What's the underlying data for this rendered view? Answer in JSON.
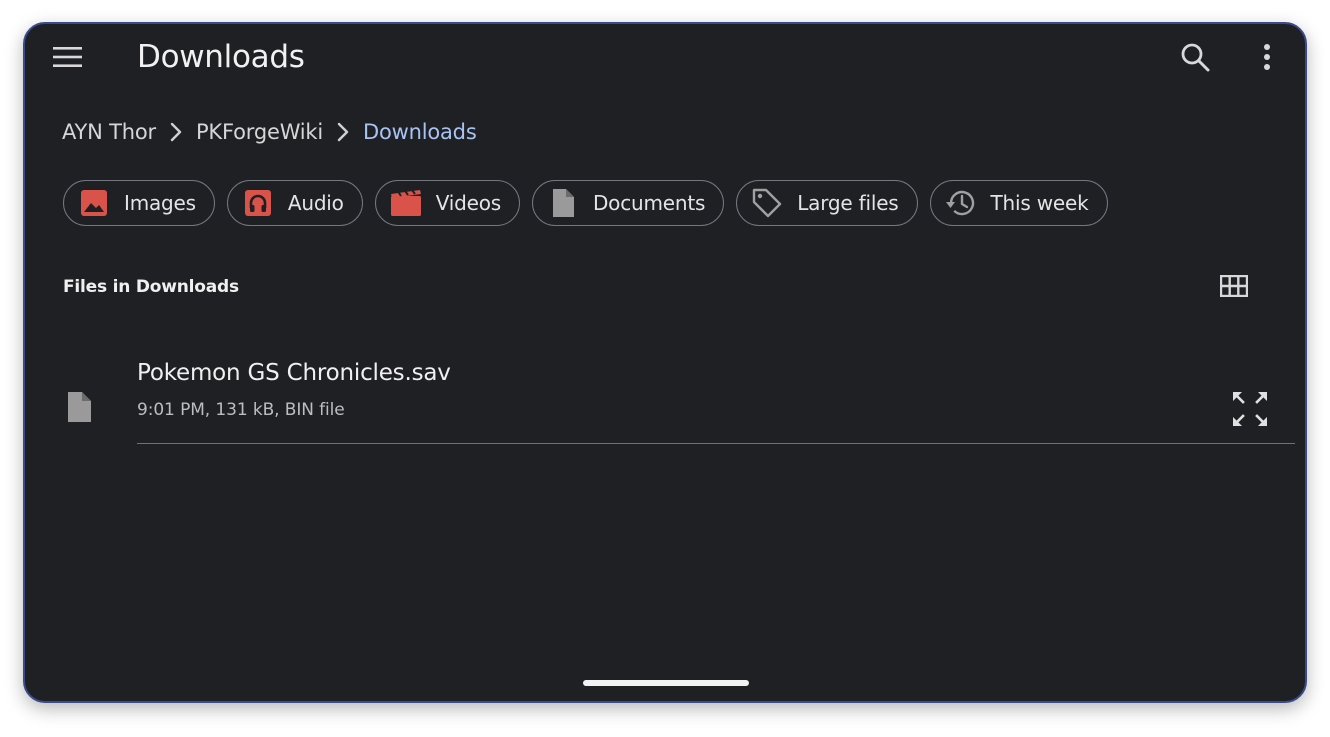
{
  "appbar": {
    "title": "Downloads",
    "menu_icon": "hamburger-menu-icon",
    "search_icon": "search-icon",
    "more_icon": "more-vert-icon"
  },
  "breadcrumb": {
    "items": [
      "AYN Thor",
      "PKForgeWiki",
      "Downloads"
    ],
    "separator_icon": "chevron-right-icon"
  },
  "chips": [
    {
      "label": "Images",
      "icon": "image-icon"
    },
    {
      "label": "Audio",
      "icon": "headphones-icon"
    },
    {
      "label": "Videos",
      "icon": "movie-icon"
    },
    {
      "label": "Documents",
      "icon": "document-icon"
    },
    {
      "label": "Large files",
      "icon": "tag-icon"
    },
    {
      "label": "This week",
      "icon": "history-icon"
    }
  ],
  "section": {
    "label": "Files in Downloads",
    "view_toggle_icon": "grid-view-icon"
  },
  "files": [
    {
      "name": "Pokemon GS Chronicles.sav",
      "meta": "9:01 PM, 131 kB, BIN file",
      "icon": "file-icon",
      "action_icon": "expand-icon"
    }
  ],
  "colors": {
    "background": "#1f2024",
    "accent": "#a8c3f2",
    "chip_icon_red": "#d9534a",
    "chip_icon_gray": "#9a9a9a"
  }
}
